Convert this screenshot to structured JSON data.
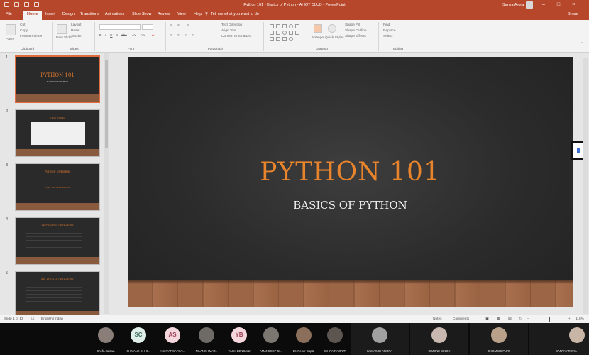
{
  "window": {
    "title": "Python 101 - Basics of Python - AI IOT CLUB - PowerPoint",
    "user": "Sanya Arora",
    "min": "–",
    "restore": "□",
    "close": "×"
  },
  "tabs": [
    {
      "label": "File"
    },
    {
      "label": "Home"
    },
    {
      "label": "Insert"
    },
    {
      "label": "Design"
    },
    {
      "label": "Transitions"
    },
    {
      "label": "Animations"
    },
    {
      "label": "Slide Show"
    },
    {
      "label": "Review"
    },
    {
      "label": "View"
    },
    {
      "label": "Help"
    }
  ],
  "tell_me": "Tell me what you want to do",
  "share": "Share",
  "ribbon": {
    "clipboard": {
      "label": "Clipboard",
      "paste": "Paste",
      "cut": "Cut",
      "copy": "Copy",
      "format_painter": "Format Painter"
    },
    "slides": {
      "label": "Slides",
      "new_slide": "New Slide",
      "layout": "Layout",
      "reset": "Reset",
      "section": "Section"
    },
    "font": {
      "label": "Font"
    },
    "paragraph": {
      "label": "Paragraph",
      "text_direction": "Text Direction",
      "align_text": "Align Text",
      "convert": "Convert to SmartArt"
    },
    "drawing": {
      "label": "Drawing",
      "arrange": "Arrange",
      "quick_styles": "Quick Styles",
      "shape_fill": "Shape Fill",
      "shape_outline": "Shape Outline",
      "shape_effects": "Shape Effects"
    },
    "editing": {
      "label": "Editing",
      "find": "Find",
      "replace": "Replace",
      "select": "Select"
    }
  },
  "thumbnails": [
    {
      "num": "1",
      "title": "PYTHON 101",
      "sub": "BASICS OF PYTHON"
    },
    {
      "num": "2",
      "title": "DATA TYPES"
    },
    {
      "num": "3",
      "title": "PYTHON NUMBERS",
      "title2": "TYPE OF OPERATORS"
    },
    {
      "num": "4",
      "title": "ARITHMETIC OPERATORS"
    },
    {
      "num": "5",
      "title": "RELATIONAL OPERATORS"
    }
  ],
  "slide": {
    "title": "PYTHON 101",
    "subtitle": "BASICS OF PYTHON"
  },
  "status": {
    "slide_of": "Slide 1 of 13",
    "language": "English (India)",
    "notes": "Notes",
    "comments": "Comments",
    "zoom": "116%"
  },
  "participants": [
    {
      "name": "Shefa Jaiswa",
      "kind": "video"
    },
    {
      "name": "SHIVANK CHHI...",
      "kind": "initials",
      "initials": "SC",
      "bg": "#dfeee8",
      "fg": "#3d6e5a"
    },
    {
      "name": "ACHYAT SAFSA...",
      "kind": "initials",
      "initials": "AS",
      "bg": "#f4d7dd",
      "fg": "#9c3e55"
    },
    {
      "name": "NILANSH MAT...",
      "kind": "video"
    },
    {
      "name": "YASH BENGANI",
      "kind": "initials",
      "initials": "YB",
      "bg": "#f4d7dd",
      "fg": "#9c3e55"
    },
    {
      "name": "AMANDEEP SI...",
      "kind": "video"
    },
    {
      "name": "Dr. Rekur Gupta",
      "kind": "video"
    },
    {
      "name": "ISHITA RAJPUT",
      "kind": "video"
    },
    {
      "name": "SAMAKSH ARORA",
      "kind": "video"
    },
    {
      "name": "SIMONE SINGH",
      "kind": "video"
    },
    {
      "name": "SHOMSHI PURI",
      "kind": "video"
    },
    {
      "name": "SANYA ARORA",
      "kind": "video"
    }
  ]
}
